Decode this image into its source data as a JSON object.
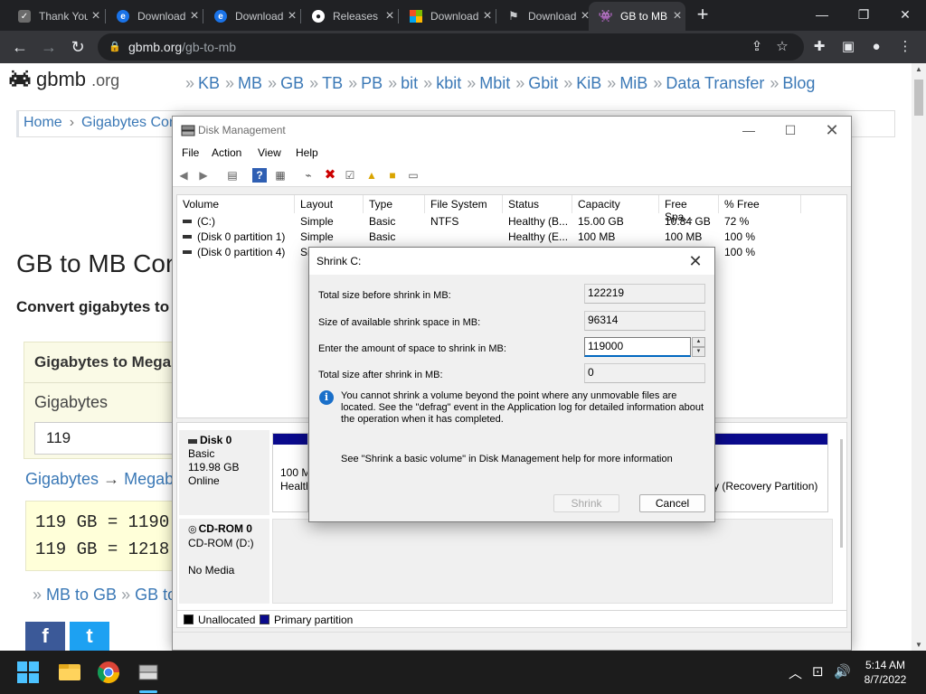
{
  "browser": {
    "tabs": [
      {
        "label": "Thank You",
        "favicon": "thank-you-favicon",
        "color": "#9aa0a6"
      },
      {
        "label": "Download",
        "favicon": "edge-favicon",
        "color": "#1a73e8"
      },
      {
        "label": "Download",
        "favicon": "edge-favicon",
        "color": "#1a73e8"
      },
      {
        "label": "Releases",
        "favicon": "github-favicon",
        "color": "#ffffff"
      },
      {
        "label": "Download",
        "favicon": "microsoft-favicon",
        "color": "#f25022"
      },
      {
        "label": "Download",
        "favicon": "download-favicon",
        "color": "#9aa0a6"
      },
      {
        "label": "GB to MB",
        "favicon": "gbmb-favicon",
        "color": "#9aa0a6"
      }
    ],
    "url_host": "gbmb.org",
    "url_path": "/gb-to-mb"
  },
  "page": {
    "logo_text": "gbmb",
    "logo_suffix": ".org",
    "nav": [
      "KB",
      "MB",
      "GB",
      "TB",
      "PB",
      "bit",
      "kbit",
      "Mbit",
      "Gbit",
      "KiB",
      "MiB",
      "Data Transfer",
      "Blog"
    ],
    "nav_sep": "»",
    "breadcrumb": [
      "Home",
      "Gigabytes Con"
    ],
    "breadcrumb_sep": "›",
    "title": "GB to MB Con",
    "subtitle": "Convert gigabytes to",
    "converter_title": "Gigabytes to Mega",
    "converter_label": "Gigabytes",
    "converter_value": "119",
    "convert_link_from": "Gigabytes",
    "convert_link_arrow": "→",
    "convert_link_to": "Megab",
    "results": [
      "119 GB = 1190",
      "119 GB = 1218"
    ],
    "bottom_links": [
      "MB to GB",
      "GB to"
    ],
    "share": [
      "f",
      "t"
    ]
  },
  "disk_management": {
    "title": "Disk Management",
    "menu": [
      "File",
      "Action",
      "View",
      "Help"
    ],
    "columns": [
      "Volume",
      "Layout",
      "Type",
      "File System",
      "Status",
      "Capacity",
      "Free Spa...",
      "% Free"
    ],
    "volumes": [
      {
        "volume": "(C:)",
        "layout": "Simple",
        "type": "Basic",
        "fs": "NTFS",
        "status": "Healthy (B...",
        "capacity": "15.00 GB",
        "free": "10.84 GB",
        "pct": "72 %"
      },
      {
        "volume": "(Disk 0 partition 1)",
        "layout": "Simple",
        "type": "Basic",
        "fs": "",
        "status": "Healthy (E...",
        "capacity": "100 MB",
        "free": "100 MB",
        "pct": "100 %"
      },
      {
        "volume": "(Disk 0 partition 4)",
        "layout": "Si",
        "type": "",
        "fs": "",
        "status": "",
        "capacity": "",
        "free": "",
        "pct": "100 %"
      }
    ],
    "disk0": {
      "name": "Disk 0",
      "type": "Basic",
      "size": "119.98 GB",
      "state": "Online",
      "part1_line1": "100 M",
      "part1_line2": "Health",
      "part3_label": "y (Recovery Partition)"
    },
    "cdrom": {
      "name": "CD-ROM 0",
      "drive": "CD-ROM (D:)",
      "media": "No Media"
    },
    "legend": {
      "unallocated": "Unallocated",
      "primary": "Primary partition"
    }
  },
  "shrink_dialog": {
    "title": "Shrink C:",
    "total_before_label": "Total size before shrink in MB:",
    "total_before_value": "122219",
    "available_label": "Size of available shrink space in MB:",
    "available_value": "96314",
    "amount_label": "Enter the amount of space to shrink in MB:",
    "amount_value": "119000",
    "after_label": "Total size after shrink in MB:",
    "after_value": "0",
    "info_text": "You cannot shrink a volume beyond the point where any unmovable files are located. See the \"defrag\" event in the Application log for detailed information about the operation when it has completed.",
    "help_text": "See \"Shrink a basic volume\" in Disk Management help for more information",
    "shrink_button": "Shrink",
    "cancel_button": "Cancel"
  },
  "taskbar": {
    "time": "5:14 AM",
    "date": "8/7/2022"
  },
  "colors": {
    "link": "#3a78b6",
    "primary_partition": "#0a0a8c",
    "accent": "#0067c0"
  }
}
